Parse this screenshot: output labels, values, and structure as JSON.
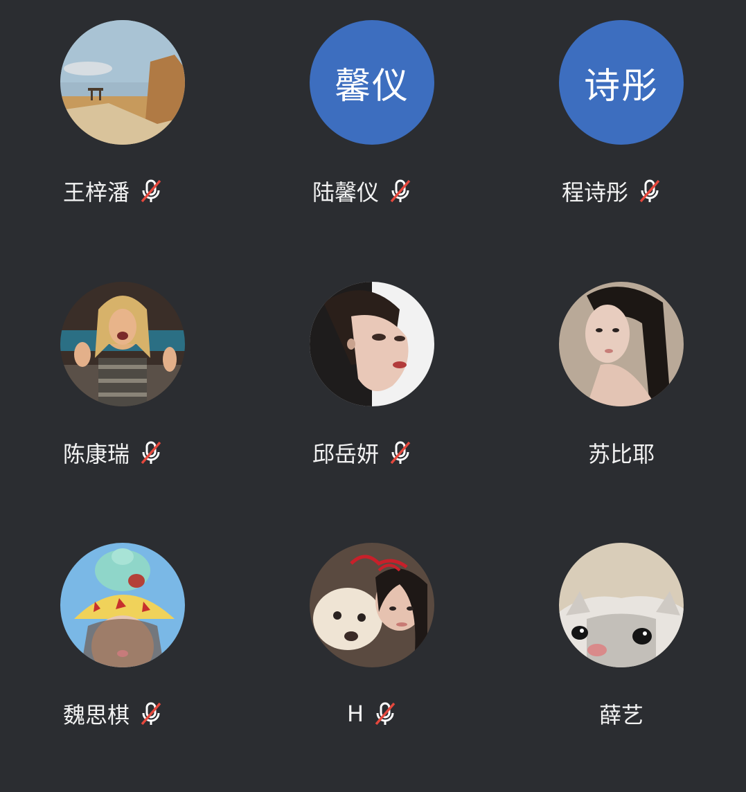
{
  "participants": [
    {
      "name": "王梓潘",
      "muted": true,
      "avatar": "photo-landscape"
    },
    {
      "name": "陆馨仪",
      "muted": true,
      "avatar_initials": "馨仪"
    },
    {
      "name": "程诗彤",
      "muted": true,
      "avatar_initials": "诗彤"
    },
    {
      "name": "陈康瑞",
      "muted": true,
      "avatar": "photo-person"
    },
    {
      "name": "邱岳妍",
      "muted": true,
      "avatar": "photo-person"
    },
    {
      "name": "苏比耶",
      "muted": false,
      "avatar": "photo-person"
    },
    {
      "name": "魏思棋",
      "muted": true,
      "avatar": "photo-person-hat"
    },
    {
      "name": "H",
      "muted": true,
      "avatar": "photo-dog-person"
    },
    {
      "name": "薛艺",
      "muted": false,
      "avatar": "photo-cat"
    }
  ],
  "colors": {
    "background": "#2b2d31",
    "initials_avatar": "#3d6ebf",
    "mute_slash": "#e5483d"
  },
  "icons": {
    "mute": "mic-muted-icon"
  }
}
